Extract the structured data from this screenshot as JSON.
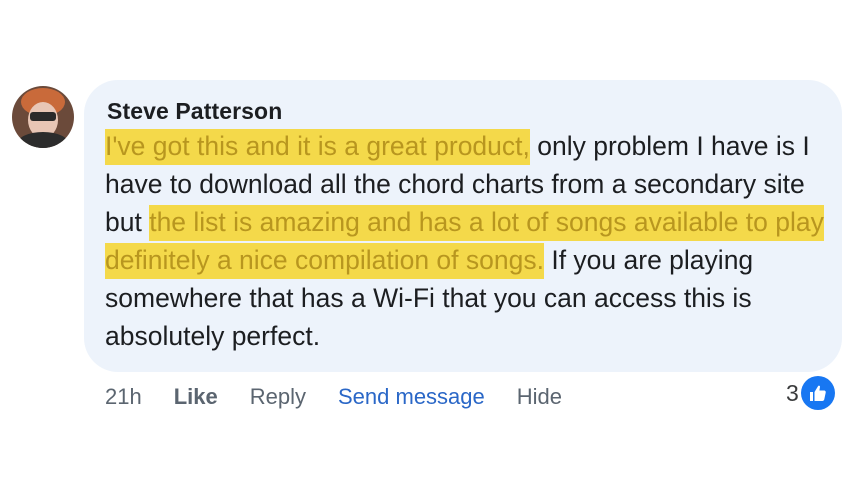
{
  "comment": {
    "author": "Steve Patterson",
    "segments": [
      {
        "text": "I've got this and it is a great product,",
        "highlight": true
      },
      {
        "text": " only problem I have is I have to download all the chord charts from a secondary site but ",
        "highlight": false
      },
      {
        "text": "the list is amazing and has a lot of songs available to play definitely a nice compilation of songs.",
        "highlight": true
      },
      {
        "text": " If you are playing somewhere that has a Wi-Fi that you can access this is absolutely perfect.",
        "highlight": false
      }
    ],
    "highlight_color": "#f4d94a"
  },
  "actions": {
    "time": "21h",
    "like_label": "Like",
    "reply_label": "Reply",
    "send_message_label": "Send message",
    "hide_label": "Hide"
  },
  "reactions": {
    "count": "3",
    "icon": "like-icon"
  }
}
